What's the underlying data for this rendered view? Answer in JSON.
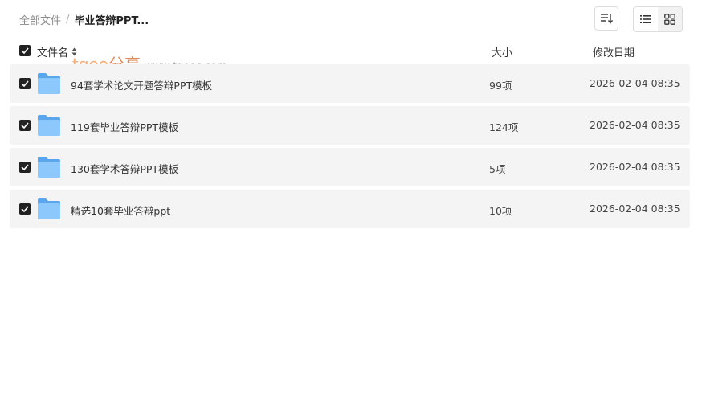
{
  "breadcrumb": {
    "root": "全部文件",
    "separator": "/",
    "current": "毕业答辩PPT..."
  },
  "toolbar": {
    "sort_icon": "sort-lines-icon",
    "list_view_icon": "list-view-icon",
    "grid_view_icon": "grid-view-icon"
  },
  "table_header": {
    "name": "文件名",
    "size": "大小",
    "date": "修改日期"
  },
  "watermark": {
    "logo_prefix": "tgoo",
    "logo_suffix": "分享",
    "url": "www.tgoos.com"
  },
  "files": [
    {
      "name": "94套学术论文开题答辩PPT模板",
      "count": "99项",
      "date": "2026-02-04 08:35"
    },
    {
      "name": "119套毕业答辩PPT模板",
      "count": "124项",
      "date": "2026-02-04 08:35"
    },
    {
      "name": "130套学术答辩PPT模板",
      "count": "5项",
      "date": "2026-02-04 08:35"
    },
    {
      "name": "精选10套毕业答辩ppt",
      "count": "10项",
      "date": "2026-02-04 08:35"
    }
  ],
  "colors": {
    "row_bg": "#f4f4f4",
    "folder_blue": "#7cbef5",
    "checkbox": "#222222"
  }
}
